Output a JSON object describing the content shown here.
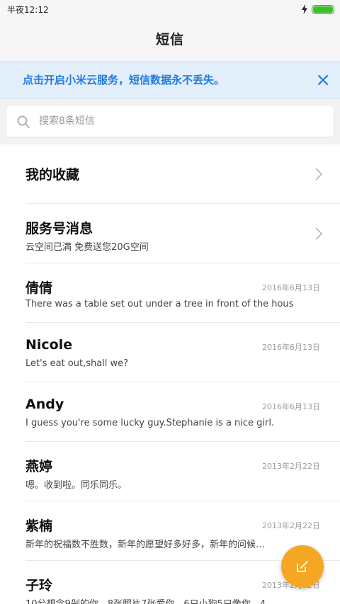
{
  "status_bar": {
    "time": "半夜12:12"
  },
  "header": {
    "title": "短信"
  },
  "banner": {
    "text": "点击开启小米云服务，短信数据永不丢失。"
  },
  "search": {
    "placeholder": "搜索8条短信"
  },
  "items": [
    {
      "name": "我的收藏",
      "preview": "",
      "date": ""
    },
    {
      "name": "服务号消息",
      "preview": "云空间已满 免费送您20G空间",
      "date": ""
    },
    {
      "name": "倩倩",
      "preview": "There was a table set out under a tree in front of the hous",
      "date": "2016年6月13日"
    },
    {
      "name": "Nicole",
      "preview": "Let's eat out,shall we?",
      "date": "2016年6月13日"
    },
    {
      "name": "Andy",
      "preview": "I guess you're some lucky guy.Stephanie is a nice girl.",
      "date": "2016年6月13日"
    },
    {
      "name": "燕婷",
      "preview": "嗯。收到啦。同乐同乐。",
      "date": "2013年2月22日"
    },
    {
      "name": "紫楠",
      "preview": "新年的祝福数不胜数，新年的愿望好多好多，新年的问候…",
      "date": "2013年2月22日"
    },
    {
      "name": "子玲",
      "preview": "10兮想念9剁的你，8张照片7张爱你，6只小狗5只像你，4…",
      "date": "2013年2月22日"
    }
  ],
  "colors": {
    "accent": "#1f7be0",
    "fab": "#f5a623",
    "battery": "#3bbf2a"
  },
  "icons": {
    "fab": "compose-icon",
    "search": "search-icon",
    "close": "close-icon",
    "chevron": "chevron-right-icon"
  }
}
